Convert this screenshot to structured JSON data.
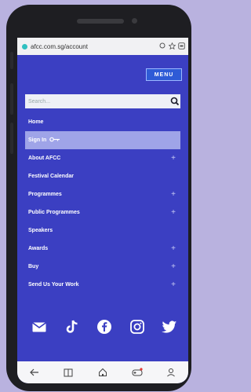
{
  "browser": {
    "url": "afcc.com.sg/account",
    "icons": [
      "tabs-circle-icon",
      "star-icon",
      "tab-count-icon"
    ]
  },
  "header": {
    "menu_label": "MENU"
  },
  "search": {
    "placeholder": "Search..."
  },
  "nav": {
    "items": [
      {
        "label": "Home",
        "expandable": false
      },
      {
        "label": "Sign In",
        "expandable": false,
        "active": true
      },
      {
        "label": "About AFCC",
        "expandable": true
      },
      {
        "label": "Festival Calendar",
        "expandable": false
      },
      {
        "label": "Programmes",
        "expandable": true
      },
      {
        "label": "Public Programmes",
        "expandable": true
      },
      {
        "label": "Speakers",
        "expandable": false
      },
      {
        "label": "Awards",
        "expandable": true
      },
      {
        "label": "Buy",
        "expandable": true
      },
      {
        "label": "Send Us Your Work",
        "expandable": true
      }
    ],
    "plus": "+"
  },
  "socials": [
    "mail-icon",
    "tiktok-icon",
    "facebook-icon",
    "instagram-icon",
    "twitter-icon"
  ],
  "bottom_bar": [
    "back-icon",
    "book-icon",
    "home-icon",
    "games-icon",
    "account-icon"
  ],
  "colors": {
    "background": "#b9b2df",
    "screen": "#3b3fc2",
    "active_row": "#9fa4e8",
    "menu_button": "#2e5bd6"
  }
}
